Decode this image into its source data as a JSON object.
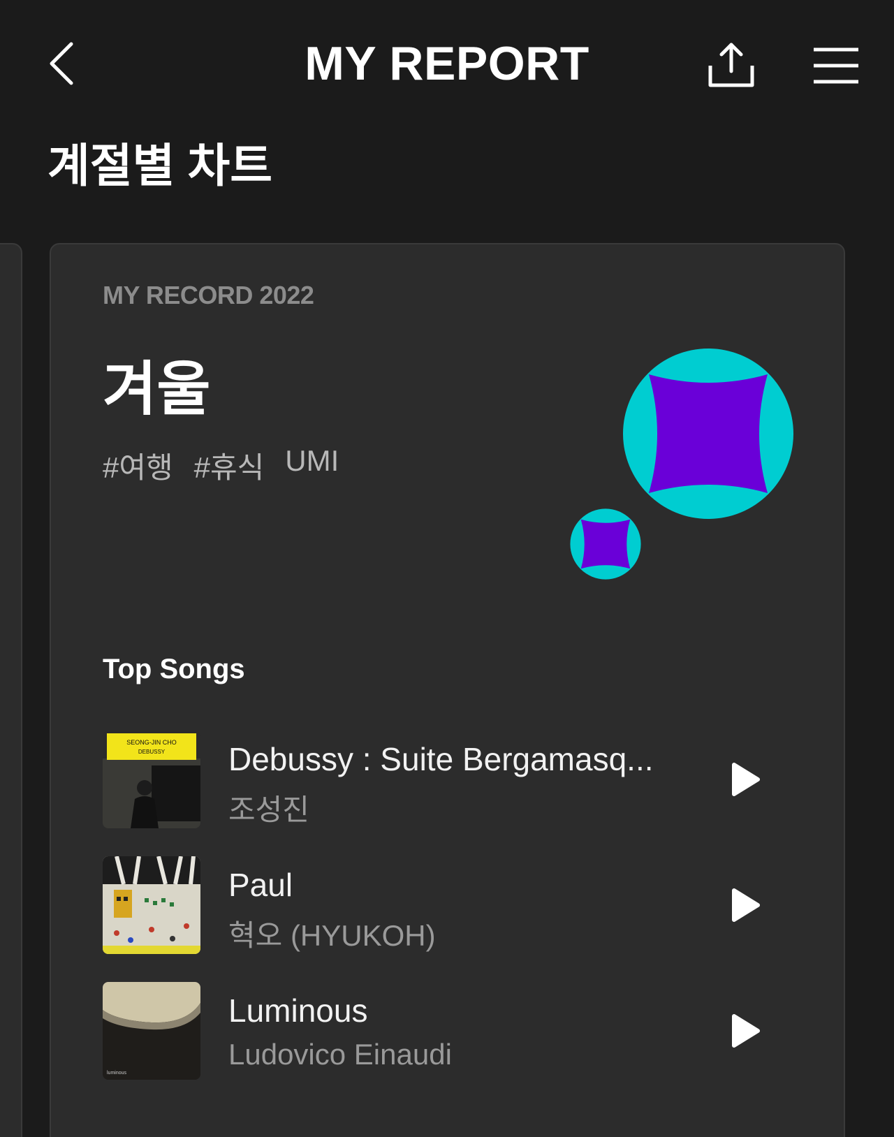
{
  "header": {
    "title": "MY REPORT",
    "back_icon": "chevron-left-icon",
    "share_icon": "share-upload-icon",
    "menu_icon": "hamburger-menu-icon"
  },
  "section": {
    "title": "계절별 차트"
  },
  "card": {
    "kicker": "MY RECORD 2022",
    "season": "겨울",
    "tags": [
      "#여행",
      "#휴식",
      "UMI"
    ],
    "art_colors": {
      "circle": "#00cdd1",
      "star": "#6a00d8"
    },
    "top_songs_label": "Top Songs",
    "songs": [
      {
        "title": "Debussy : Suite Bergamasq...",
        "artist": "조성진",
        "cover_label": "SEONG-JIN CHO",
        "cover_sub": "DEBUSSY"
      },
      {
        "title": "Paul",
        "artist": "혁오 (HYUKOH)"
      },
      {
        "title": "Luminous",
        "artist": "Ludovico Einaudi",
        "cover_label": "luminous"
      }
    ]
  },
  "colors": {
    "background": "#1b1b1b",
    "card": "#2c2c2c",
    "muted_text": "#8c8c8c"
  }
}
